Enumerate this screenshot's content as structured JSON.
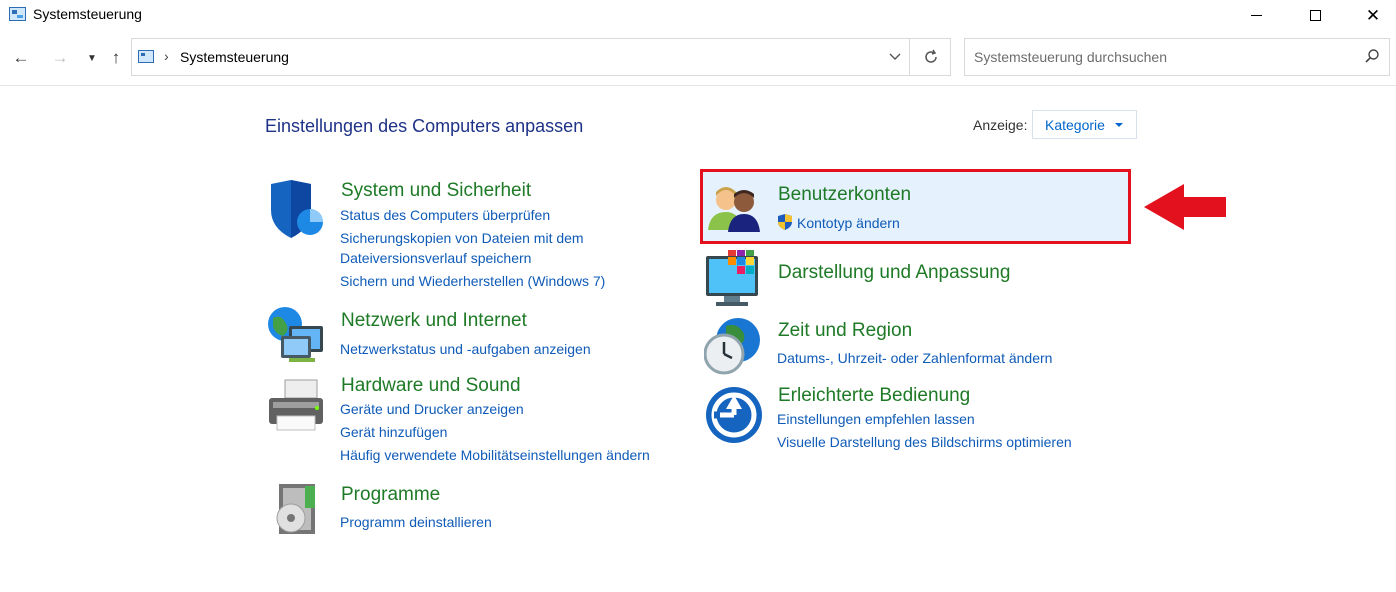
{
  "window": {
    "title": "Systemsteuerung"
  },
  "navigation": {
    "address_text": "Systemsteuerung",
    "search_placeholder": "Systemsteuerung durchsuchen"
  },
  "header": {
    "title": "Einstellungen des Computers anpassen",
    "view_label": "Anzeige:",
    "view_value": "Kategorie"
  },
  "categories": [
    {
      "title": "System und Sicherheit",
      "icon": "shield-icon",
      "links": [
        "Status des Computers überprüfen",
        "Sicherungskopien von Dateien mit dem",
        "Dateiversionsverlauf speichern",
        "Sichern und Wiederherstellen (Windows 7)"
      ]
    },
    {
      "title": "Netzwerk und Internet",
      "icon": "network-icon",
      "links": [
        "Netzwerkstatus und -aufgaben anzeigen"
      ]
    },
    {
      "title": "Hardware und Sound",
      "icon": "printer-icon",
      "links": [
        "Geräte und Drucker anzeigen",
        "Gerät hinzufügen",
        "Häufig verwendete Mobilitätseinstellungen ändern"
      ]
    },
    {
      "title": "Programme",
      "icon": "programs-icon",
      "links": [
        "Programm deinstallieren"
      ]
    },
    {
      "title": "Benutzerkonten",
      "icon": "users-icon",
      "links": [
        "Kontotyp ändern"
      ]
    },
    {
      "title": "Darstellung und Anpassung",
      "icon": "display-icon",
      "links": []
    },
    {
      "title": "Zeit und Region",
      "icon": "clock-globe-icon",
      "links": [
        "Datums-, Uhrzeit- oder Zahlenformat ändern"
      ]
    },
    {
      "title": "Erleichterte Bedienung",
      "icon": "accessibility-icon",
      "links": [
        "Einstellungen empfehlen lassen",
        "Visuelle Darstellung des Bildschirms optimieren"
      ]
    }
  ],
  "colors": {
    "category_title": "#1e7a26",
    "link": "#0f5bb8",
    "page_title": "#1e3287",
    "highlight_border": "#e3101d",
    "highlight_fill": "#e5f1fc"
  }
}
